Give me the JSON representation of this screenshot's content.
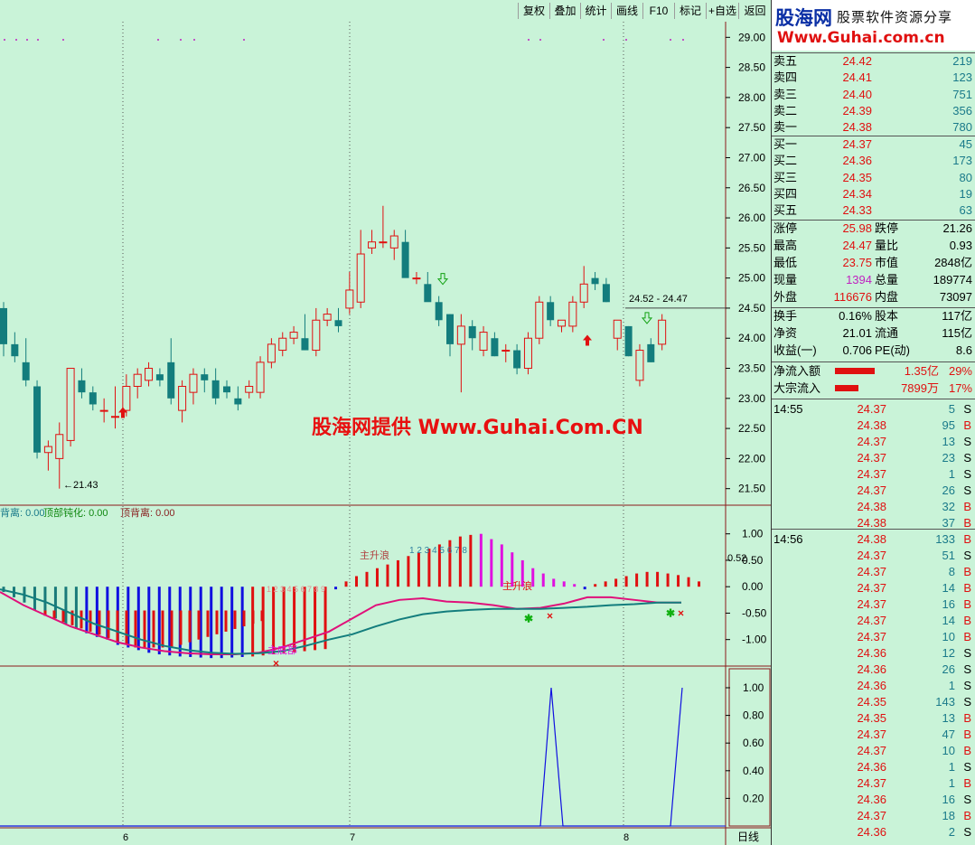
{
  "toolbar": {
    "buttons": [
      "复权",
      "叠加",
      "统计",
      "画线",
      "F10",
      "标记",
      "+自选",
      "返回"
    ]
  },
  "price_axis": {
    "ticks": [
      "29.00",
      "28.50",
      "28.00",
      "27.50",
      "27.00",
      "26.50",
      "26.00",
      "25.50",
      "25.00",
      "24.50",
      "24.00",
      "23.50",
      "23.00",
      "22.50",
      "22.00",
      "21.50"
    ],
    "ylim": [
      21.3,
      29.2
    ]
  },
  "candles": [
    {
      "o": 24.5,
      "h": 24.6,
      "l": 23.7,
      "c": 23.9
    },
    {
      "o": 23.9,
      "h": 24.1,
      "l": 23.6,
      "c": 23.7
    },
    {
      "o": 23.6,
      "h": 24.0,
      "l": 23.2,
      "c": 23.3
    },
    {
      "o": 23.2,
      "h": 23.3,
      "l": 22.0,
      "c": 22.1
    },
    {
      "o": 22.1,
      "h": 22.3,
      "l": 21.8,
      "c": 22.2
    },
    {
      "o": 22.0,
      "h": 22.6,
      "l": 21.5,
      "c": 22.4
    },
    {
      "o": 22.3,
      "h": 23.5,
      "l": 22.2,
      "c": 23.5
    },
    {
      "o": 23.3,
      "h": 23.5,
      "l": 23.0,
      "c": 23.1
    },
    {
      "o": 23.1,
      "h": 23.2,
      "l": 22.8,
      "c": 22.9
    },
    {
      "o": 22.8,
      "h": 23.0,
      "l": 22.6,
      "c": 22.8
    },
    {
      "o": 22.7,
      "h": 23.2,
      "l": 22.5,
      "c": 22.7
    },
    {
      "o": 22.8,
      "h": 23.4,
      "l": 22.7,
      "c": 23.2
    },
    {
      "o": 23.2,
      "h": 23.5,
      "l": 23.0,
      "c": 23.4
    },
    {
      "o": 23.3,
      "h": 23.6,
      "l": 23.2,
      "c": 23.5
    },
    {
      "o": 23.4,
      "h": 23.5,
      "l": 23.2,
      "c": 23.3
    },
    {
      "o": 23.6,
      "h": 24.0,
      "l": 22.9,
      "c": 23.0
    },
    {
      "o": 22.8,
      "h": 23.3,
      "l": 22.6,
      "c": 23.2
    },
    {
      "o": 23.1,
      "h": 23.5,
      "l": 22.9,
      "c": 23.4
    },
    {
      "o": 23.4,
      "h": 23.5,
      "l": 23.1,
      "c": 23.3
    },
    {
      "o": 23.3,
      "h": 23.5,
      "l": 22.9,
      "c": 23.0
    },
    {
      "o": 23.2,
      "h": 23.3,
      "l": 23.0,
      "c": 23.1
    },
    {
      "o": 23.0,
      "h": 23.2,
      "l": 22.8,
      "c": 22.9
    },
    {
      "o": 23.1,
      "h": 23.3,
      "l": 23.0,
      "c": 23.2
    },
    {
      "o": 23.1,
      "h": 23.7,
      "l": 23.0,
      "c": 23.6
    },
    {
      "o": 23.6,
      "h": 24.0,
      "l": 23.5,
      "c": 23.9
    },
    {
      "o": 23.8,
      "h": 24.1,
      "l": 23.7,
      "c": 24.0
    },
    {
      "o": 24.0,
      "h": 24.2,
      "l": 23.9,
      "c": 24.1
    },
    {
      "o": 24.0,
      "h": 24.4,
      "l": 23.8,
      "c": 23.8
    },
    {
      "o": 23.8,
      "h": 24.5,
      "l": 23.7,
      "c": 24.3
    },
    {
      "o": 24.3,
      "h": 24.5,
      "l": 24.2,
      "c": 24.4
    },
    {
      "o": 24.3,
      "h": 24.5,
      "l": 24.1,
      "c": 24.2
    },
    {
      "o": 24.5,
      "h": 25.1,
      "l": 24.4,
      "c": 24.8
    },
    {
      "o": 24.6,
      "h": 25.8,
      "l": 24.5,
      "c": 25.4
    },
    {
      "o": 25.5,
      "h": 25.8,
      "l": 25.4,
      "c": 25.6
    },
    {
      "o": 25.6,
      "h": 26.2,
      "l": 25.5,
      "c": 25.6
    },
    {
      "o": 25.5,
      "h": 25.8,
      "l": 25.3,
      "c": 25.7
    },
    {
      "o": 25.6,
      "h": 25.8,
      "l": 25.3,
      "c": 25.0
    },
    {
      "o": 25.0,
      "h": 25.1,
      "l": 24.9,
      "c": 25.0
    },
    {
      "o": 24.9,
      "h": 25.1,
      "l": 24.7,
      "c": 24.6
    },
    {
      "o": 24.6,
      "h": 24.7,
      "l": 24.2,
      "c": 24.3
    },
    {
      "o": 24.4,
      "h": 24.4,
      "l": 23.7,
      "c": 23.9
    },
    {
      "o": 23.9,
      "h": 24.4,
      "l": 23.1,
      "c": 24.2
    },
    {
      "o": 24.2,
      "h": 24.3,
      "l": 23.8,
      "c": 24.0
    },
    {
      "o": 23.8,
      "h": 24.2,
      "l": 23.7,
      "c": 24.1
    },
    {
      "o": 24.0,
      "h": 24.1,
      "l": 23.7,
      "c": 23.7
    },
    {
      "o": 23.8,
      "h": 23.9,
      "l": 23.6,
      "c": 23.8
    },
    {
      "o": 23.8,
      "h": 23.9,
      "l": 23.4,
      "c": 23.5
    },
    {
      "o": 23.5,
      "h": 24.1,
      "l": 23.4,
      "c": 24.0
    },
    {
      "o": 24.0,
      "h": 24.7,
      "l": 23.9,
      "c": 24.6
    },
    {
      "o": 24.6,
      "h": 24.7,
      "l": 24.2,
      "c": 24.3
    },
    {
      "o": 24.2,
      "h": 24.3,
      "l": 24.1,
      "c": 24.3
    },
    {
      "o": 24.2,
      "h": 24.7,
      "l": 24.1,
      "c": 24.6
    },
    {
      "o": 24.6,
      "h": 25.2,
      "l": 24.5,
      "c": 24.9
    },
    {
      "o": 25.0,
      "h": 25.1,
      "l": 24.8,
      "c": 24.9
    },
    {
      "o": 24.9,
      "h": 25.0,
      "l": 24.6,
      "c": 24.6
    },
    {
      "o": 24.0,
      "h": 24.3,
      "l": 23.8,
      "c": 24.3
    },
    {
      "o": 24.2,
      "h": 24.2,
      "l": 23.7,
      "c": 23.7
    },
    {
      "o": 23.3,
      "h": 23.9,
      "l": 23.2,
      "c": 23.8
    },
    {
      "o": 23.9,
      "h": 24.0,
      "l": 23.6,
      "c": 23.6
    },
    {
      "o": 23.9,
      "h": 24.4,
      "l": 23.8,
      "c": 24.3
    }
  ],
  "labels": {
    "low_label": "←21.43",
    "range_label": "24.52 - 24.47",
    "date_6": "6",
    "date_7": "7",
    "date_8": "8",
    "period": "日线"
  },
  "indicator": {
    "header_a": "背离: 0.00",
    "header_b": "顶部钝化: 0.00",
    "header_c": "顶背离: 0.00",
    "ticks": [
      "1.00",
      "0.50",
      "0.00",
      "-0.50",
      "-1.00"
    ],
    "current_value": "0.52",
    "label_main_up": "主升浪",
    "label_main_up2": "主升浪",
    "label_bottom": "主底部",
    "count_red": "1 2 3 4 5 6 7 8 9",
    "count_mag": "1 2 3 4 5 6 7 8",
    "histogram": [
      -0.1,
      -0.2,
      -0.3,
      -0.45,
      -0.5,
      -0.6,
      -0.7,
      -0.8,
      -0.88,
      -0.95,
      -1.0,
      -1.1,
      -1.15,
      -1.2,
      -1.25,
      -1.28,
      -1.3,
      -1.32,
      -1.33,
      -1.34,
      -1.35,
      -1.35,
      -1.34,
      -1.33,
      -1.32,
      -1.3,
      -1.28,
      -1.26,
      -1.24,
      -1.22,
      -1.2,
      -1.18,
      -0.05,
      0.1,
      0.2,
      0.28,
      0.35,
      0.42,
      0.5,
      0.58,
      0.65,
      0.72,
      0.8,
      0.88,
      0.95,
      0.98,
      1.0,
      0.9,
      0.8,
      0.65,
      0.5,
      0.35,
      0.25,
      0.15,
      0.1,
      0.05,
      -0.05,
      0.05,
      0.1,
      0.15,
      0.2,
      0.25,
      0.28,
      0.28,
      0.25,
      0.22,
      0.18,
      0.1
    ]
  },
  "bottom_panel": {
    "ticks": [
      "1.00",
      "0.80",
      "0.60",
      "0.40",
      "0.20"
    ]
  },
  "quote": {
    "sell": [
      {
        "label": "卖五",
        "price": "24.42",
        "vol": "219"
      },
      {
        "label": "卖四",
        "price": "24.41",
        "vol": "123"
      },
      {
        "label": "卖三",
        "price": "24.40",
        "vol": "751"
      },
      {
        "label": "卖二",
        "price": "24.39",
        "vol": "356"
      },
      {
        "label": "卖一",
        "price": "24.38",
        "vol": "780"
      }
    ],
    "buy": [
      {
        "label": "买一",
        "price": "24.37",
        "vol": "45"
      },
      {
        "label": "买二",
        "price": "24.36",
        "vol": "173"
      },
      {
        "label": "买三",
        "price": "24.35",
        "vol": "80"
      },
      {
        "label": "买四",
        "price": "24.34",
        "vol": "19"
      },
      {
        "label": "买五",
        "price": "24.33",
        "vol": "63"
      }
    ],
    "stats1": [
      {
        "l1": "涨停",
        "v1": "25.98",
        "l2": "跌停",
        "v2": "21.26"
      },
      {
        "l1": "最高",
        "v1": "24.47",
        "l2": "量比",
        "v2": "0.93"
      },
      {
        "l1": "最低",
        "v1": "23.75",
        "l2": "市值",
        "v2": "2848亿"
      },
      {
        "l1": "现量",
        "v1": "1394",
        "l2": "总量",
        "v2": "189774"
      },
      {
        "l1": "外盘",
        "v1": "116676",
        "l2": "内盘",
        "v2": "73097"
      }
    ],
    "stats2": [
      {
        "l1": "换手",
        "v1": "0.16%",
        "l2": "股本",
        "v2": "117亿"
      },
      {
        "l1": "净资",
        "v1": "21.01",
        "l2": "流通",
        "v2": "115亿"
      },
      {
        "l1": "收益(一)",
        "v1": "0.706",
        "l2": "PE(动)",
        "v2": "8.6"
      }
    ],
    "flow": [
      {
        "label": "净流入额",
        "value": "1.35亿",
        "pct": "29%"
      },
      {
        "label": "大宗流入",
        "value": "7899万",
        "pct": "17%"
      }
    ],
    "ticks_group1_time": "14:55",
    "ticks_group1": [
      {
        "p": "24.37",
        "v": "5",
        "s": "S"
      },
      {
        "p": "24.38",
        "v": "95",
        "s": "B"
      },
      {
        "p": "24.37",
        "v": "13",
        "s": "S"
      },
      {
        "p": "24.37",
        "v": "23",
        "s": "S"
      },
      {
        "p": "24.37",
        "v": "1",
        "s": "S"
      },
      {
        "p": "24.37",
        "v": "26",
        "s": "S"
      },
      {
        "p": "24.38",
        "v": "32",
        "s": "B"
      },
      {
        "p": "24.38",
        "v": "37",
        "s": "B"
      }
    ],
    "ticks_group2_time": "14:56",
    "ticks_group2": [
      {
        "p": "24.38",
        "v": "133",
        "s": "B"
      },
      {
        "p": "24.37",
        "v": "51",
        "s": "S"
      },
      {
        "p": "24.37",
        "v": "8",
        "s": "B"
      },
      {
        "p": "24.37",
        "v": "14",
        "s": "B"
      },
      {
        "p": "24.37",
        "v": "16",
        "s": "B"
      },
      {
        "p": "24.37",
        "v": "14",
        "s": "B"
      },
      {
        "p": "24.37",
        "v": "10",
        "s": "B"
      },
      {
        "p": "24.36",
        "v": "12",
        "s": "S"
      },
      {
        "p": "24.36",
        "v": "26",
        "s": "S"
      },
      {
        "p": "24.36",
        "v": "1",
        "s": "S"
      },
      {
        "p": "24.35",
        "v": "143",
        "s": "S"
      },
      {
        "p": "24.35",
        "v": "13",
        "s": "B"
      },
      {
        "p": "24.37",
        "v": "47",
        "s": "B"
      },
      {
        "p": "24.37",
        "v": "10",
        "s": "B"
      },
      {
        "p": "24.36",
        "v": "1",
        "s": "S"
      },
      {
        "p": "24.37",
        "v": "1",
        "s": "B"
      },
      {
        "p": "24.36",
        "v": "16",
        "s": "S"
      },
      {
        "p": "24.37",
        "v": "18",
        "s": "B"
      },
      {
        "p": "24.36",
        "v": "2",
        "s": "S"
      }
    ]
  },
  "logo": {
    "brand": "股海网",
    "tagline": "股票软件资源分享",
    "url": "Www.Guhai.com.cn"
  },
  "watermark": "股海网提供 Www.Guhai.Com.CN",
  "colors": {
    "up": "#e01010",
    "down": "#137d7d",
    "bg": "#c9f3d8",
    "blue": "#1010e0",
    "magenta": "#e010e0"
  }
}
